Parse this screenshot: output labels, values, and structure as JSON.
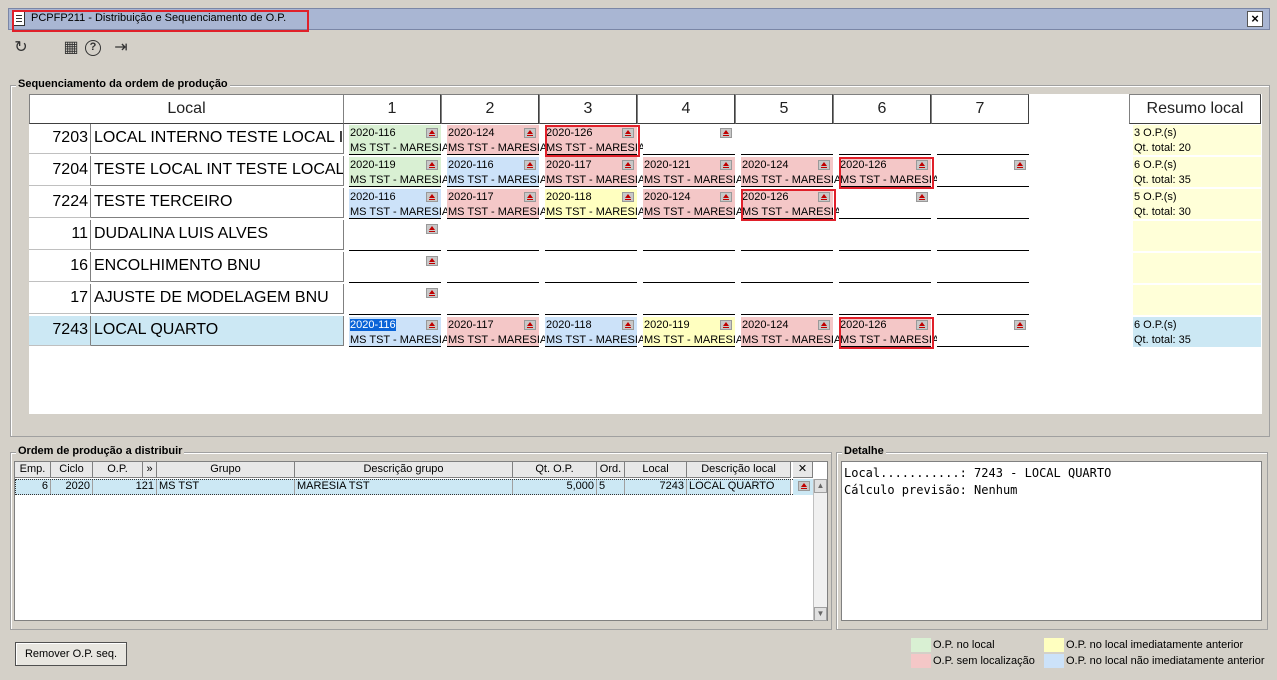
{
  "window": {
    "title": "PCPFP211 - Distribuição e Sequenciamento de O.P.",
    "close": "×"
  },
  "toolbar": {
    "icons": [
      "refresh-icon",
      "calendar-icon",
      "help-icon",
      "exit-icon"
    ],
    "refresh": "↻",
    "calendar": "▦",
    "help": "?",
    "exit": "⇥"
  },
  "seq": {
    "label": "Sequenciamento da ordem de produção",
    "col_local": "Local",
    "cols": [
      "1",
      "2",
      "3",
      "4",
      "5",
      "6",
      "7"
    ],
    "col_summary": "Resumo local",
    "rows": [
      {
        "num": "7203",
        "name": "LOCAL INTERNO TESTE LOCAL I",
        "cells": [
          {
            "op": "2020-116",
            "grp": "MS TST - MARESIA",
            "c": "green"
          },
          {
            "op": "2020-124",
            "grp": "MS TST - MARESIA",
            "c": "pink"
          },
          {
            "op": "2020-126",
            "grp": "MS TST - MARESIA",
            "c": "pink"
          }
        ],
        "s1": "3 O.P.(s)",
        "s2": "Qt. total: 20"
      },
      {
        "num": "7204",
        "name": "TESTE LOCAL INT TESTE LOCAL",
        "cells": [
          {
            "op": "2020-119",
            "grp": "MS TST - MARESIA",
            "c": "green"
          },
          {
            "op": "2020-116",
            "grp": "MS TST - MARESIA",
            "c": "blue"
          },
          {
            "op": "2020-117",
            "grp": "MS TST - MARESIA",
            "c": "pink"
          },
          {
            "op": "2020-121",
            "grp": "MS TST - MARESIA",
            "c": "pink"
          },
          {
            "op": "2020-124",
            "grp": "MS TST - MARESIA",
            "c": "pink"
          },
          {
            "op": "2020-126",
            "grp": "MS TST - MARESIA",
            "c": "pink"
          }
        ],
        "s1": "6 O.P.(s)",
        "s2": "Qt. total: 35"
      },
      {
        "num": "7224",
        "name": "TESTE TERCEIRO",
        "cells": [
          {
            "op": "2020-116",
            "grp": "MS TST - MARESIA",
            "c": "blue"
          },
          {
            "op": "2020-117",
            "grp": "MS TST - MARESIA",
            "c": "pink"
          },
          {
            "op": "2020-118",
            "grp": "MS TST - MARESIA",
            "c": "yellow"
          },
          {
            "op": "2020-124",
            "grp": "MS TST - MARESIA",
            "c": "pink"
          },
          {
            "op": "2020-126",
            "grp": "MS TST - MARESIA",
            "c": "pink"
          }
        ],
        "s1": "5 O.P.(s)",
        "s2": "Qt. total: 30"
      },
      {
        "num": "11",
        "name": "DUDALINA LUIS ALVES",
        "cells": [],
        "s1": "",
        "s2": ""
      },
      {
        "num": "16",
        "name": "ENCOLHIMENTO BNU",
        "cells": [],
        "s1": "",
        "s2": ""
      },
      {
        "num": "17",
        "name": "AJUSTE DE MODELAGEM BNU",
        "cells": [],
        "s1": "",
        "s2": ""
      },
      {
        "num": "7243",
        "name": "LOCAL QUARTO",
        "cells": [
          {
            "op": "2020-116",
            "grp": "MS TST - MARESIA",
            "c": "blue"
          },
          {
            "op": "2020-117",
            "grp": "MS TST - MARESIA",
            "c": "pink"
          },
          {
            "op": "2020-118",
            "grp": "MS TST - MARESIA",
            "c": "blue"
          },
          {
            "op": "2020-119",
            "grp": "MS TST - MARESIA",
            "c": "yellow"
          },
          {
            "op": "2020-124",
            "grp": "MS TST - MARESIA",
            "c": "pink"
          },
          {
            "op": "2020-126",
            "grp": "MS TST - MARESIA",
            "c": "pink"
          }
        ],
        "s1": "6 O.P.(s)",
        "s2": "Qt. total: 35"
      }
    ]
  },
  "dist": {
    "label": "Ordem de produção a distribuir",
    "headers": [
      "Emp.",
      "Ciclo",
      "O.P.",
      "»",
      "Grupo",
      "Descrição grupo",
      "Qt. O.P.",
      "Ord.",
      "Local",
      "Descrição local"
    ],
    "row": [
      "6",
      "2020",
      "121",
      "MS TST",
      "MARESIA TST",
      "5,000",
      "5",
      "7243",
      "LOCAL QUARTO"
    ]
  },
  "detail": {
    "label": "Detalhe",
    "lines": [
      "Local...........: 7243 - LOCAL QUARTO",
      "Cálculo previsão: Nenhum"
    ]
  },
  "buttons": {
    "remove": "Remover O.P. seq."
  },
  "legend": {
    "green": "O.P. no local",
    "pink": "O.P. sem localização",
    "yellow": "O.P. no local imediatamente anterior",
    "blue": "O.P. no local não imediatamente anterior"
  },
  "colors": {
    "green": "#d9f0d3",
    "pink": "#f4c7c7",
    "yellow": "#ffffc0",
    "blue": "#cce2f9",
    "selected": "#cce8f4",
    "highlight": "#e0202a"
  }
}
